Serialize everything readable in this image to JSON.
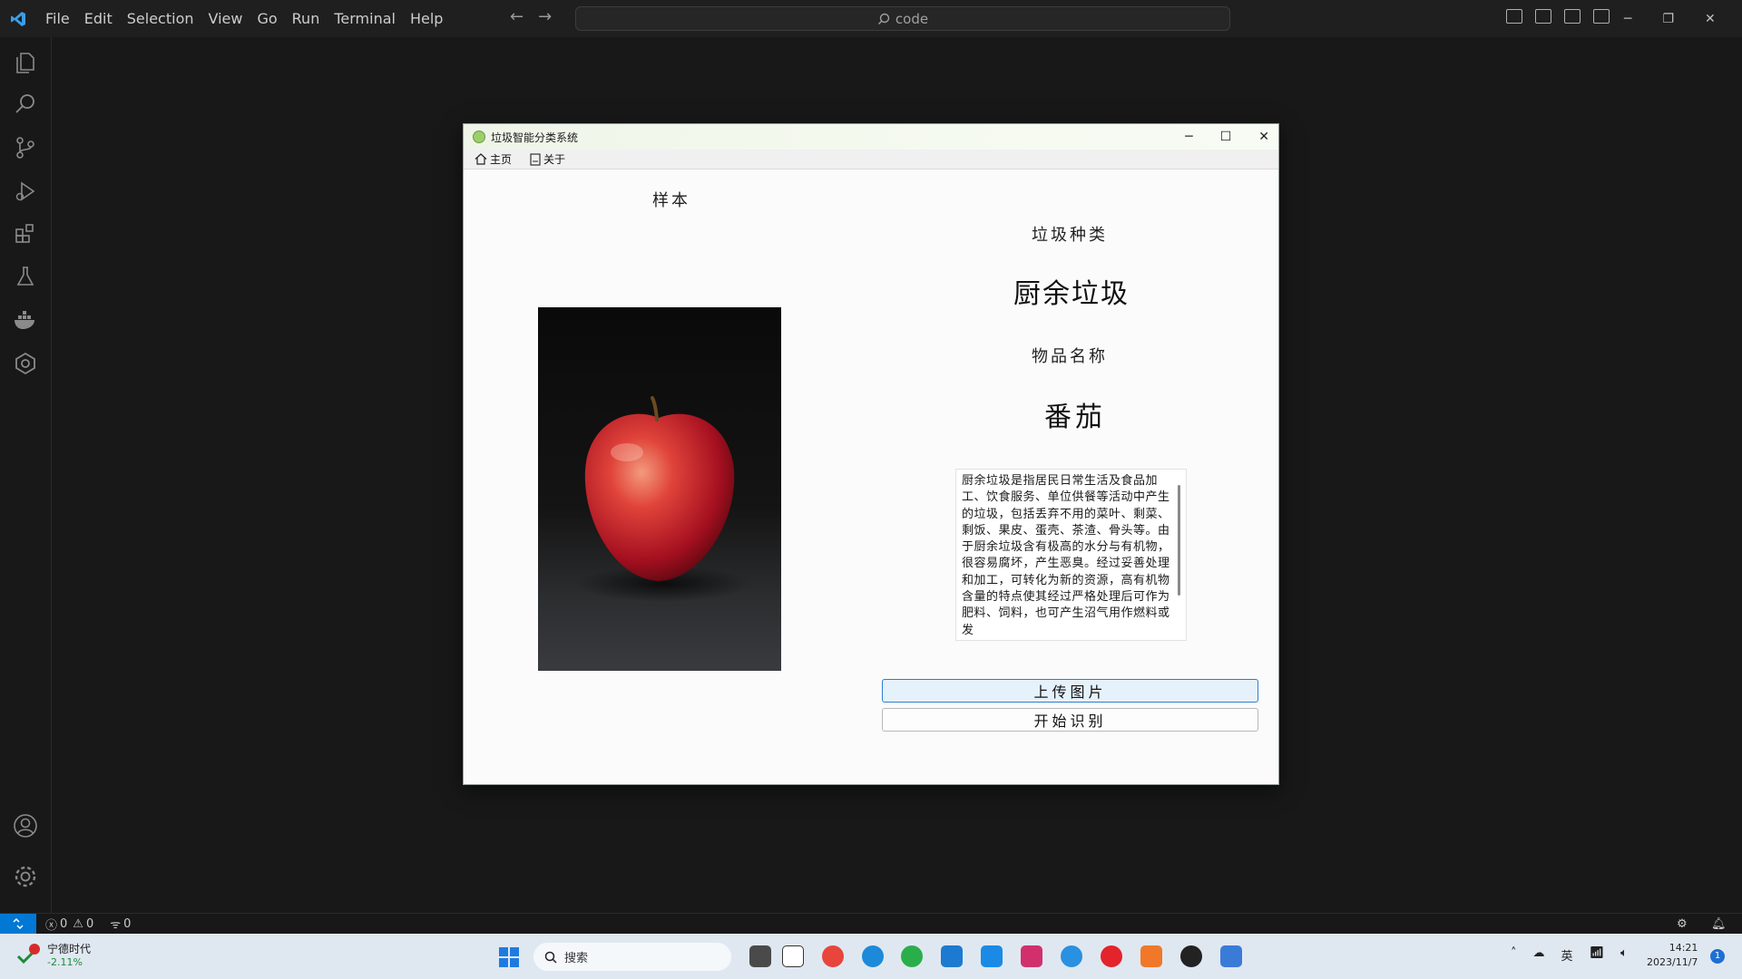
{
  "vscode": {
    "menu": [
      "File",
      "Edit",
      "Selection",
      "View",
      "Go",
      "Run",
      "Terminal",
      "Help"
    ],
    "command_center": "code",
    "status": {
      "errors": "0",
      "warnings": "0",
      "ports": "0"
    }
  },
  "app_window": {
    "title": "垃圾智能分类系统",
    "tabs": [
      {
        "label": "主页",
        "icon": "home-icon"
      },
      {
        "label": "关于",
        "icon": "document-icon"
      }
    ],
    "sample_label": "样本",
    "category_label": "垃圾种类",
    "category_value": "厨余垃圾",
    "item_label": "物品名称",
    "item_value": "番茄",
    "description": "厨余垃圾是指居民日常生活及食品加工、饮食服务、单位供餐等活动中产生的垃圾，包括丢弃不用的菜叶、剩菜、剩饭、果皮、蛋壳、茶渣、骨头等。由于厨余垃圾含有极高的水分与有机物，很容易腐坏，产生恶臭。经过妥善处理和加工，可转化为新的资源，高有机物含量的特点使其经过严格处理后可作为肥料、饲料，也可产生沼气用作燃料或发",
    "upload_button": "上传图片",
    "start_button": "开始识别",
    "image_description_icon": "apple-photo"
  },
  "taskbar": {
    "stock_name": "宁德时代",
    "stock_change": "-2.11%",
    "stock_badge": "1",
    "search_placeholder": "搜索",
    "ime": "英",
    "time": "14:21",
    "date": "2023/11/7",
    "notification_count": "1"
  },
  "colors": {
    "vscode_bg": "#181818",
    "accent_blue": "#0078d4",
    "upload_border": "#2b7fd0",
    "taskbar_bg": "#dfe8f1"
  }
}
